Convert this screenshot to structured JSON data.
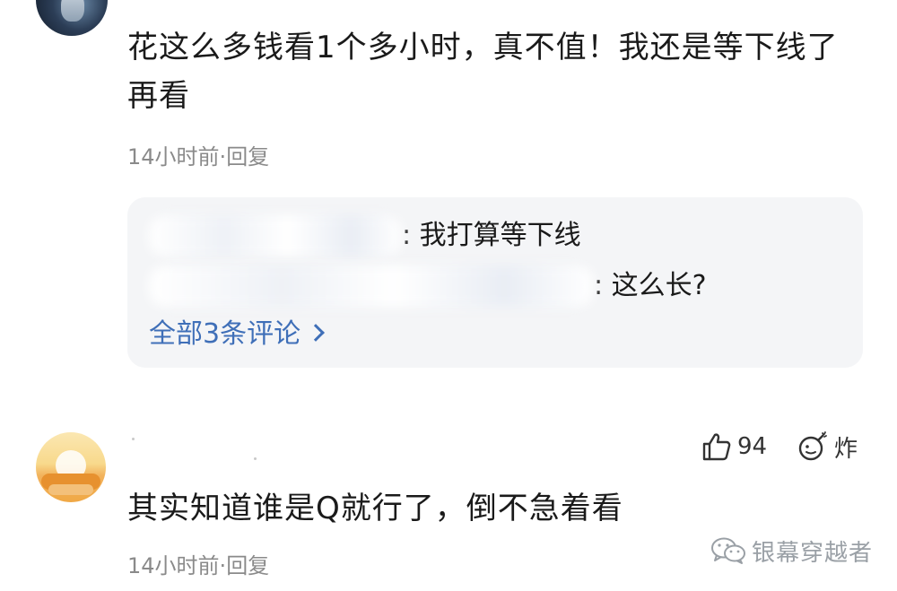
{
  "comments": [
    {
      "text": "花这么多钱看1个多小时，真不值！我还是等下线了再看",
      "time": "14小时前",
      "separator": "·",
      "reply_label": "回复",
      "replies": [
        {
          "text": ": 我打算等下线"
        },
        {
          "text": ": 这么长?"
        }
      ],
      "view_all": "全部3条评论"
    },
    {
      "text": "其实知道谁是Q就行了，倒不急着看",
      "time": "14小时前",
      "separator": "·",
      "reply_label": "回复",
      "likes": "94",
      "bomb_label": "炸"
    }
  ],
  "watermark": {
    "text": "银幕穿越者",
    "icon": "wechat-icon"
  },
  "colors": {
    "link": "#3f6fb8",
    "meta": "#8a8a8a",
    "reply_bg": "#f4f5f7"
  }
}
